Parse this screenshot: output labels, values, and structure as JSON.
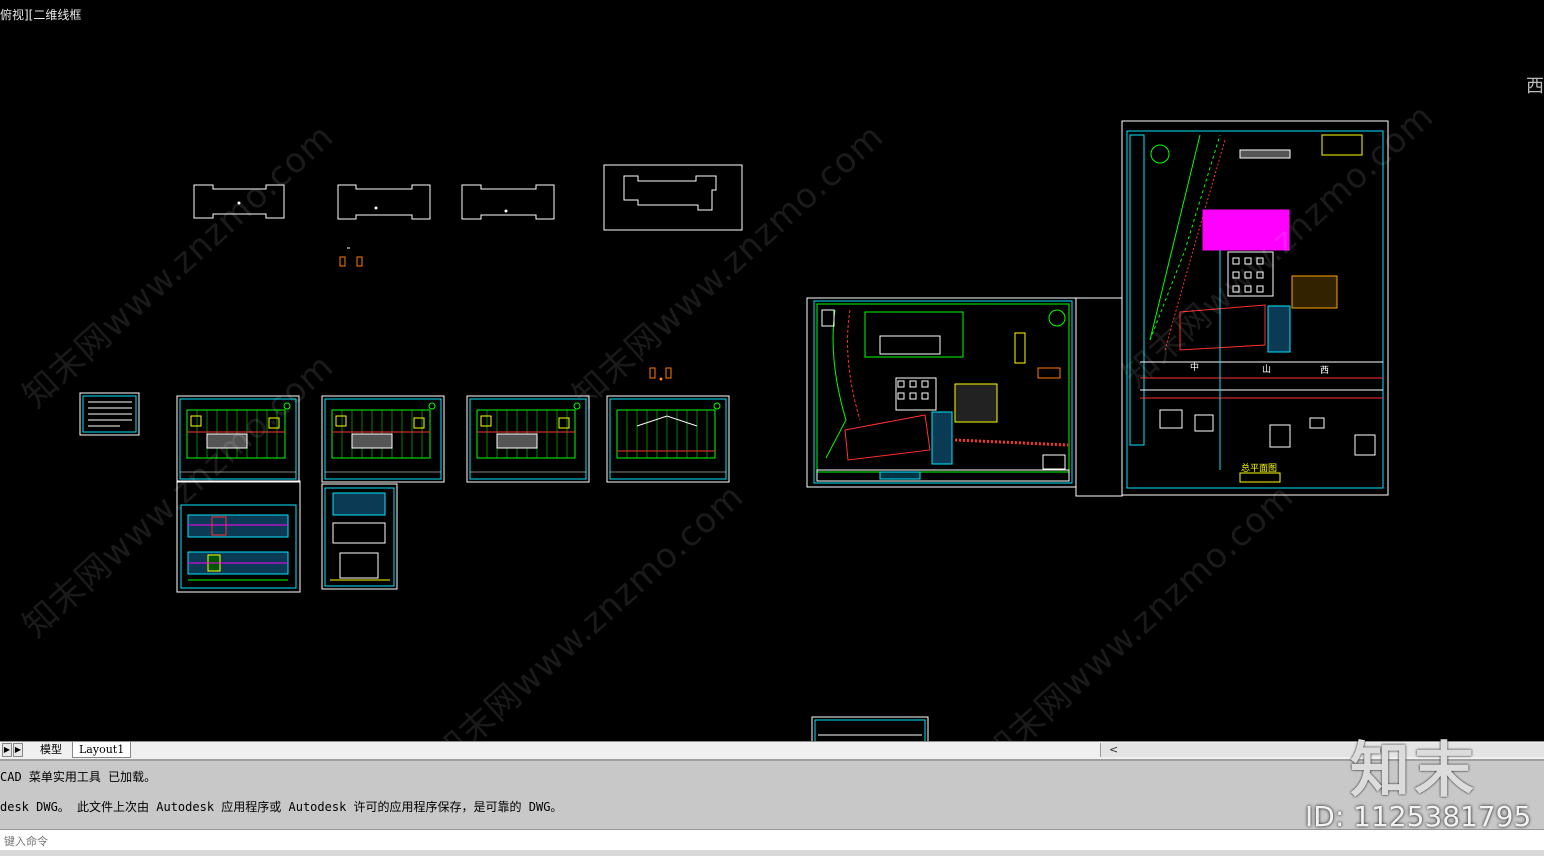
{
  "viewport": {
    "label": "俯视][二维线框",
    "edge_glyph": "西"
  },
  "watermarks": [
    "知末网www.znzmo.com",
    "知末网www.znzmo.com",
    "知末网www.znzmo.com",
    "知末网www.znzmo.com",
    "知末网www.znzmo.com",
    "知末网www.znzmo.com"
  ],
  "drawing": {
    "site_plan_title": "总平面图",
    "road_label_1": "中",
    "road_label_2": "山",
    "road_label_3": "西"
  },
  "tabs": {
    "model": "模型",
    "layout1": "Layout1"
  },
  "command_history": [
    "CAD 菜单实用工具 已加载。",
    "desk DWG。  此文件上次由 Autodesk 应用程序或 Autodesk 许可的应用程序保存，是可靠的 DWG。"
  ],
  "command_input": {
    "placeholder": "键入命令"
  },
  "brand": {
    "logo": "知末",
    "id": "ID: 1125381795"
  },
  "colors": {
    "background": "#000000",
    "green": "#00ff00",
    "cyan": "#00e5ff",
    "magenta": "#ff00ff",
    "red": "#ff3030",
    "yellow": "#ffff00"
  }
}
